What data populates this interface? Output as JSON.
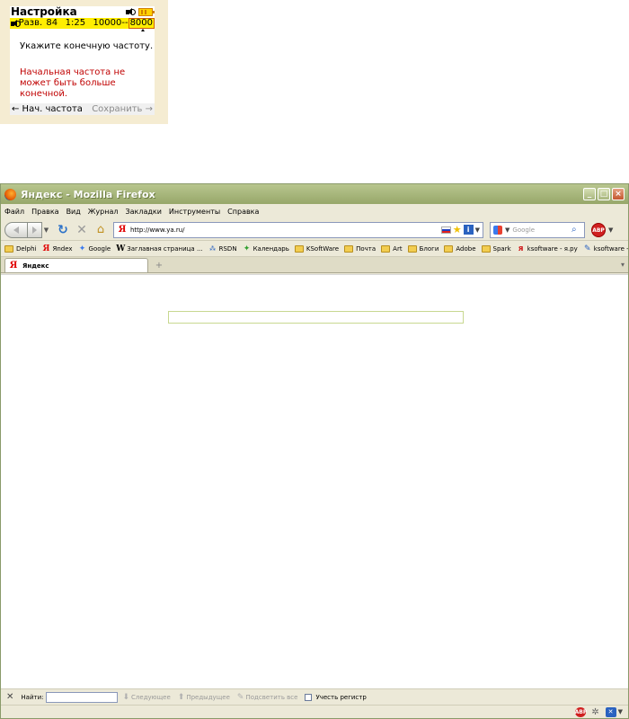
{
  "device": {
    "title": "Настройка",
    "status": {
      "mode": "Разв.",
      "channel": "84",
      "time": "1:25",
      "freq_start": "10000",
      "separator": "--",
      "freq_end": "8000"
    },
    "prompt": "Укажите конечную частоту.",
    "error": "Начальная частота не может быть больше конечной.",
    "softkey_left": "← Нач. частота",
    "softkey_right": "Сохранить →",
    "colors": {
      "status_bg": "#ffee00",
      "error_text": "#c00000",
      "panel_bg": "#f5ecd2"
    }
  },
  "firefox": {
    "window_title": "Яндекс - Mozilla Firefox",
    "menu": [
      "Файл",
      "Правка",
      "Вид",
      "Журнал",
      "Закладки",
      "Инструменты",
      "Справка"
    ],
    "url": "http://www.ya.ru/",
    "search_placeholder": "Google",
    "abp_label": "ABP",
    "bookmarks": [
      {
        "label": "Delphi",
        "icon": "folder-icon"
      },
      {
        "label": "Яndex",
        "icon": "yandex-icon"
      },
      {
        "label": "Google",
        "icon": "google-icon"
      },
      {
        "label": "Заглавная страница ...",
        "icon": "wikipedia-icon"
      },
      {
        "label": "RSDN",
        "icon": "rsdn-icon"
      },
      {
        "label": "Календарь",
        "icon": "calendar-icon"
      },
      {
        "label": "KSoftWare",
        "icon": "folder-icon"
      },
      {
        "label": "Почта",
        "icon": "folder-icon"
      },
      {
        "label": "Art",
        "icon": "folder-icon"
      },
      {
        "label": "Блоги",
        "icon": "folder-icon"
      },
      {
        "label": "Adobe",
        "icon": "folder-icon"
      },
      {
        "label": "Spark",
        "icon": "folder-icon"
      },
      {
        "label": "ksoftware - я.ру",
        "icon": "yaru-icon"
      },
      {
        "label": "ksoftware - Мой днев...",
        "icon": "pen-icon"
      }
    ],
    "tab_label": "Яндекс",
    "findbar": {
      "label": "Найти:",
      "next": "Следующее",
      "prev": "Предыдущее",
      "highlight": "Подсветить все",
      "match_case": "Учесть регистр"
    }
  }
}
